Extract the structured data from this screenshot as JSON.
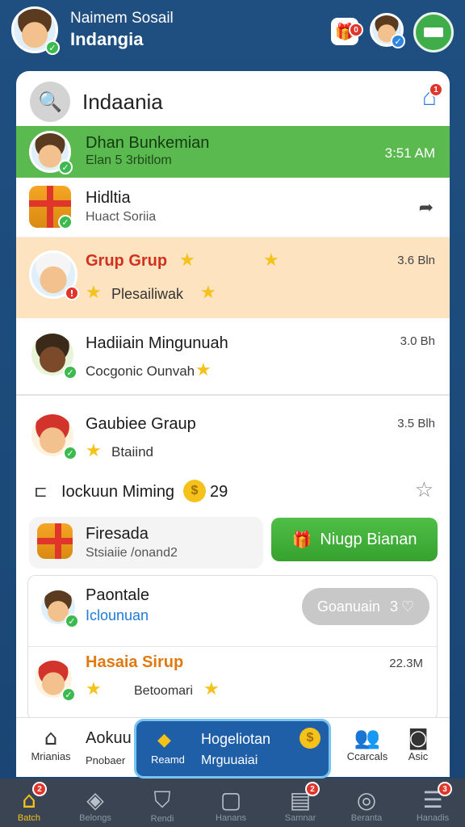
{
  "header": {
    "name": "Naimem Sosail",
    "subtitle": "Indangia",
    "gift_badge": "0",
    "avatar_check": "✓"
  },
  "card": {
    "title": "Indaania",
    "home_badge": "1"
  },
  "rows": [
    {
      "title": "Dhan Bunkemian",
      "sub": "Elan 5 3rbitlom",
      "time": "3:51 AM"
    },
    {
      "title": "Hidltia",
      "sub": "Huact Soriia"
    },
    {
      "title": "Grup Grup",
      "sub": "Plesailiwak",
      "time": "3.6 Bln"
    },
    {
      "title": "Hadiiain Mingunuah",
      "sub": "Cocgonic Ounvah",
      "time": "3.0 Bh"
    },
    {
      "title": "Gaubiee Graup",
      "sub": "Btaiind",
      "time": "3.5 Blh"
    },
    {
      "title": "Iockuun Miming",
      "sub": "29"
    },
    {
      "title": "Firesada",
      "sub": "Stsiaiie /onand2"
    },
    {
      "title": "Paontale",
      "sub": "Iclounuan"
    },
    {
      "title": "Hasaia Sirup",
      "sub": "Betoomari",
      "time": "22.3M"
    }
  ],
  "buttons": {
    "green": "Niugp Bianan",
    "grey": "Goanuain",
    "grey_count": "3"
  },
  "bottom_menu": {
    "left1_label": "Mrianias",
    "left2_title": "Aokuu",
    "left2_sub": "Pnobaer",
    "promo_title": "Hogeliotan",
    "promo_left": "Reamd",
    "promo_sub": "Mrguuaiai",
    "right1_label": "Ccarcals",
    "right2_label": "Asic"
  },
  "navbar": {
    "items": [
      {
        "label": "Batch",
        "badge": "2"
      },
      {
        "label": "Belongs"
      },
      {
        "label": "Rendi"
      },
      {
        "label": "Hanans"
      },
      {
        "label": "Samnar",
        "badge": "2"
      },
      {
        "label": "Beranta"
      },
      {
        "label": "Hanadis",
        "badge": "3"
      }
    ]
  },
  "colors": {
    "accent_green": "#4fbf46",
    "highlight_row": "#fde3bf",
    "top_row_green": "#5bba4f",
    "navbar": "#3a4453"
  }
}
